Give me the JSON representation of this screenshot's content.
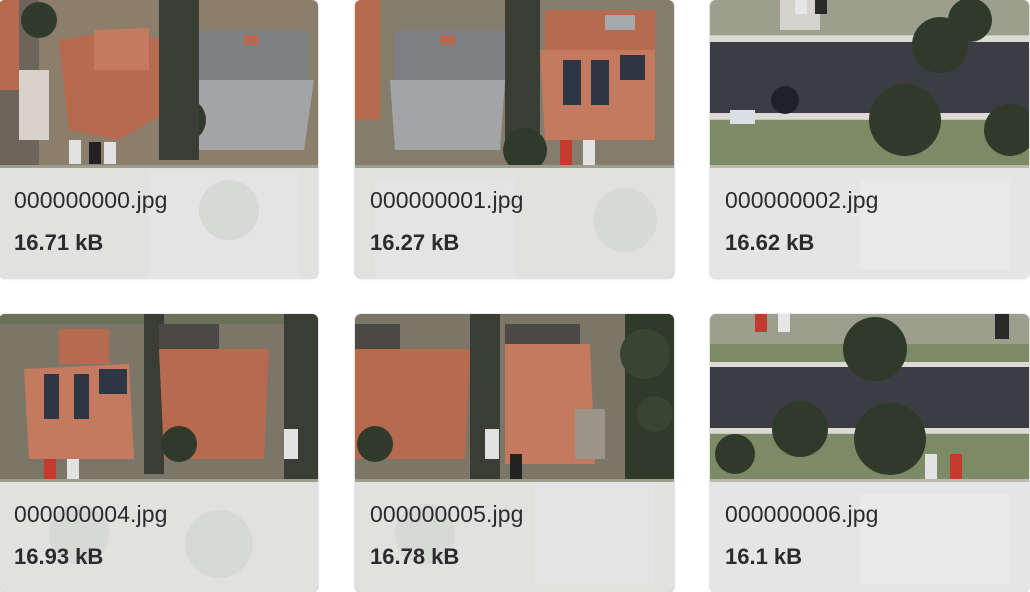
{
  "files": [
    {
      "name": "000000000.jpg",
      "size": "16.71 kB"
    },
    {
      "name": "000000001.jpg",
      "size": "16.27 kB"
    },
    {
      "name": "000000002.jpg",
      "size": "16.62 kB"
    },
    {
      "name": "000000004.jpg",
      "size": "16.93 kB"
    },
    {
      "name": "000000005.jpg",
      "size": "16.78 kB"
    },
    {
      "name": "000000006.jpg",
      "size": "16.1 kB"
    }
  ],
  "colors": {
    "caption_bg": "#ececee",
    "text": "#2b2b2b",
    "roof_terracotta": "#b86a4e",
    "roof_gray": "#8d8e90",
    "asphalt": "#3b3d42",
    "tree": "#2f3a2a",
    "lawn": "#7d8a66"
  }
}
